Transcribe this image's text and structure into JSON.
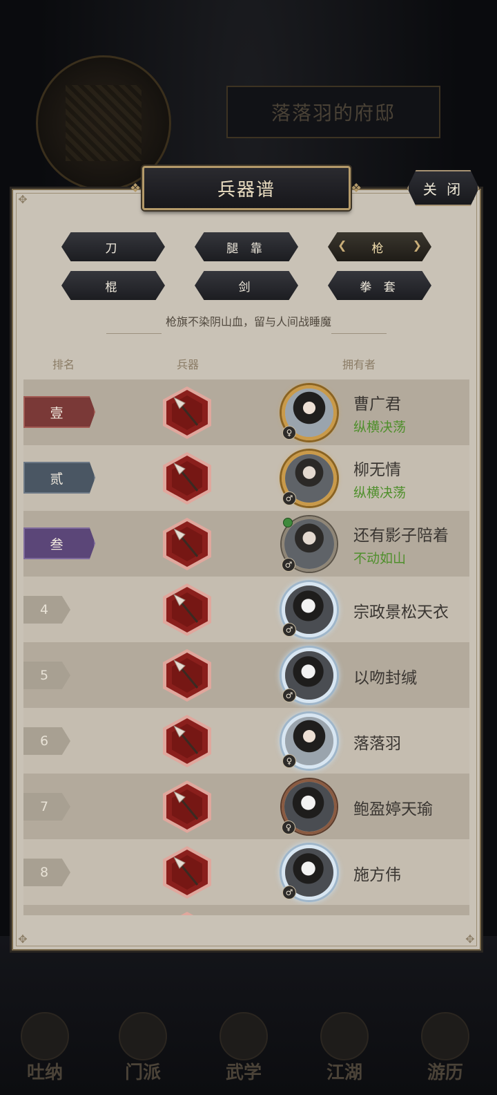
{
  "background": {
    "mansion_title": "落落羽的府邸",
    "bottom_tabs": [
      "吐纳",
      "门派",
      "武学",
      "江湖",
      "游历"
    ]
  },
  "dialog": {
    "title": "兵器谱",
    "close_label": "关 闭",
    "categories": [
      {
        "label": "刀",
        "active": false
      },
      {
        "label": "腿 靠",
        "active": false
      },
      {
        "label": "枪",
        "active": true
      },
      {
        "label": "棍",
        "active": false
      },
      {
        "label": "剑",
        "active": false
      },
      {
        "label": "拳 套",
        "active": false
      }
    ],
    "motto": "枪旗不染阴山血，留与人间战睡魔",
    "columns": {
      "rank": "排名",
      "weapon": "兵器",
      "owner": "拥有者"
    },
    "rows": [
      {
        "rank": "壹",
        "weapon_icon": "spear-icon",
        "owner": "曹广君",
        "title": "纵横决荡",
        "gender": "♀",
        "frame": "gold"
      },
      {
        "rank": "贰",
        "weapon_icon": "spear-icon",
        "owner": "柳无情",
        "title": "纵横决荡",
        "gender": "♂",
        "frame": "gold"
      },
      {
        "rank": "叁",
        "weapon_icon": "spear-icon",
        "owner": "还有影子陪着",
        "title": "不动如山",
        "gender": "♂",
        "frame": "plain"
      },
      {
        "rank": "4",
        "weapon_icon": "spear-icon",
        "owner": "宗政景松天衣",
        "title": "",
        "gender": "♂",
        "frame": "silver"
      },
      {
        "rank": "5",
        "weapon_icon": "spear-icon",
        "owner": "以吻封缄",
        "title": "",
        "gender": "♂",
        "frame": "silver"
      },
      {
        "rank": "6",
        "weapon_icon": "spear-icon",
        "owner": "落落羽",
        "title": "",
        "gender": "♀",
        "frame": "silver"
      },
      {
        "rank": "7",
        "weapon_icon": "spear-icon",
        "owner": "鲍盈婷天瑜",
        "title": "",
        "gender": "♀",
        "frame": "bronze"
      },
      {
        "rank": "8",
        "weapon_icon": "spear-icon",
        "owner": "施方伟",
        "title": "",
        "gender": "♂",
        "frame": "silver"
      }
    ]
  },
  "colors": {
    "panel_bg": "#c9c2b6",
    "rank1": "#7a3937",
    "rank2": "#4a5663",
    "rank3": "#5b4678",
    "title_green": "#4f8f2c",
    "weapon_hex": "#8a1f1c"
  }
}
